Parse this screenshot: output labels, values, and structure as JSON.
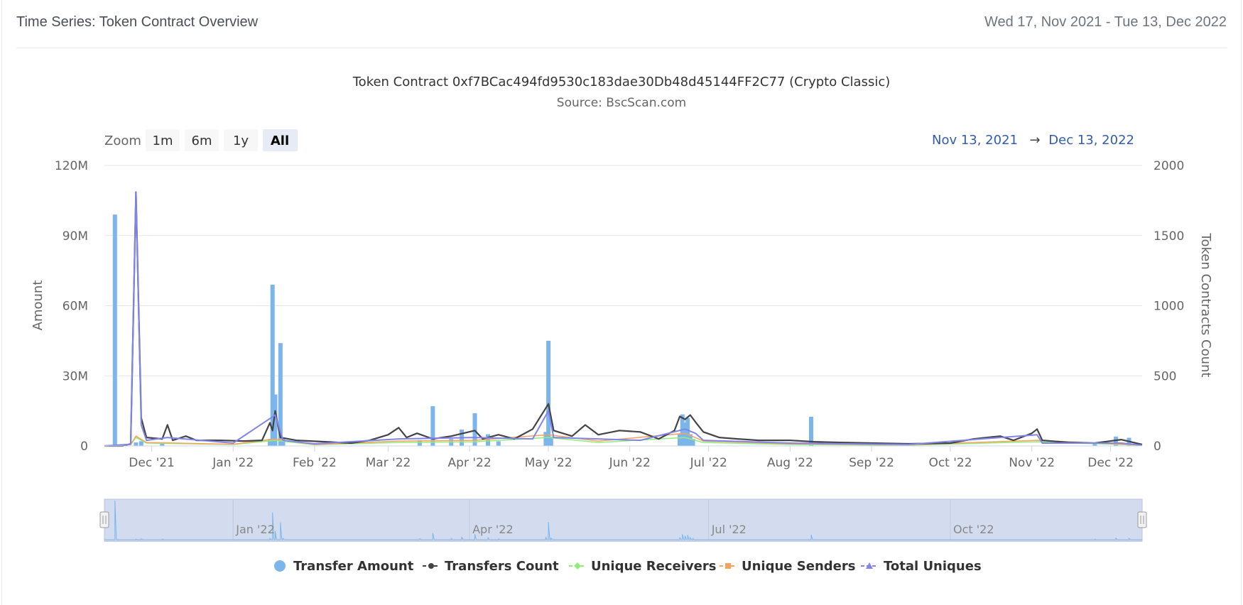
{
  "header": {
    "title": "Time Series: Token Contract Overview",
    "date_range": "Wed 17, Nov 2021 - Tue 13, Dec 2022"
  },
  "range_selector": {
    "zoom_label": "Zoom",
    "buttons": [
      "1m",
      "6m",
      "1y",
      "All"
    ],
    "selected": "All",
    "from": "Nov 13, 2021",
    "arrow": "→",
    "to": "Dec 13, 2022"
  },
  "navigator_labels": [
    "Jan '22",
    "Apr '22",
    "Jul '22",
    "Oct '22"
  ],
  "colors": {
    "transfer_amount": "#7cb5ec",
    "transfers_count": "#434348",
    "unique_receivers": "#90ed7d",
    "unique_senders": "#f7a35c",
    "total_uniques": "#8085e9",
    "navigator_fill": "#d3dcef"
  },
  "chart_data": {
    "type": "bar",
    "title": "Token Contract 0xf7BCac494fd9530c183dae30Db48d45144FF2C77 (Crypto Classic)",
    "subtitle": "Source: BscScan.com",
    "ylabel": "Amount",
    "y2label": "Token Contracts Count",
    "ylim": [
      0,
      120000000
    ],
    "y2lim": [
      0,
      2000
    ],
    "yticks": [
      "0",
      "30M",
      "60M",
      "90M",
      "120M"
    ],
    "y2ticks": [
      "0",
      "500",
      "1000",
      "1500",
      "2000"
    ],
    "xlim": [
      "2021-11-13",
      "2022-12-13"
    ],
    "xticks": [
      {
        "label": "Dec '21",
        "date": "2021-12-01"
      },
      {
        "label": "Jan '22",
        "date": "2022-01-01"
      },
      {
        "label": "Feb '22",
        "date": "2022-02-01"
      },
      {
        "label": "Mar '22",
        "date": "2022-03-01"
      },
      {
        "label": "Apr '22",
        "date": "2022-04-01"
      },
      {
        "label": "May '22",
        "date": "2022-05-01"
      },
      {
        "label": "Jun '22",
        "date": "2022-06-01"
      },
      {
        "label": "Jul '22",
        "date": "2022-07-01"
      },
      {
        "label": "Aug '22",
        "date": "2022-08-01"
      },
      {
        "label": "Sep '22",
        "date": "2022-09-01"
      },
      {
        "label": "Oct '22",
        "date": "2022-10-01"
      },
      {
        "label": "Nov '22",
        "date": "2022-11-01"
      },
      {
        "label": "Dec '22",
        "date": "2022-12-01"
      }
    ],
    "grid": true,
    "legend_position": "bottom-center",
    "series": [
      {
        "name": "Transfer Amount",
        "type": "column",
        "axis": "left",
        "points": [
          [
            "2021-11-17",
            99000000
          ],
          [
            "2021-11-25",
            1500000
          ],
          [
            "2021-11-27",
            2000000
          ],
          [
            "2021-12-05",
            1000000
          ],
          [
            "2022-01-15",
            3000000
          ],
          [
            "2022-01-16",
            69000000
          ],
          [
            "2022-01-17",
            22000000
          ],
          [
            "2022-01-19",
            44000000
          ],
          [
            "2022-01-20",
            3000000
          ],
          [
            "2022-03-13",
            2500000
          ],
          [
            "2022-03-18",
            17000000
          ],
          [
            "2022-03-25",
            3000000
          ],
          [
            "2022-03-29",
            7000000
          ],
          [
            "2022-04-03",
            14000000
          ],
          [
            "2022-04-08",
            5000000
          ],
          [
            "2022-04-12",
            2000000
          ],
          [
            "2022-04-30",
            6000000
          ],
          [
            "2022-05-01",
            45000000
          ],
          [
            "2022-05-02",
            4000000
          ],
          [
            "2022-06-20",
            5000000
          ],
          [
            "2022-06-21",
            13500000
          ],
          [
            "2022-06-22",
            10000000
          ],
          [
            "2022-06-23",
            12000000
          ],
          [
            "2022-06-24",
            5000000
          ],
          [
            "2022-06-25",
            3000000
          ],
          [
            "2022-08-09",
            12500000
          ],
          [
            "2022-11-25",
            1000000
          ],
          [
            "2022-12-03",
            4000000
          ],
          [
            "2022-12-08",
            3500000
          ]
        ]
      },
      {
        "name": "Transfers Count",
        "type": "line",
        "axis": "right",
        "points": [
          [
            "2021-11-13",
            0
          ],
          [
            "2021-11-20",
            0
          ],
          [
            "2021-11-23",
            15
          ],
          [
            "2021-11-25",
            1810
          ],
          [
            "2021-11-27",
            200
          ],
          [
            "2021-11-29",
            60
          ],
          [
            "2021-12-05",
            50
          ],
          [
            "2021-12-07",
            150
          ],
          [
            "2021-12-09",
            40
          ],
          [
            "2021-12-14",
            70
          ],
          [
            "2021-12-18",
            40
          ],
          [
            "2021-12-27",
            40
          ],
          [
            "2022-01-05",
            35
          ],
          [
            "2022-01-12",
            40
          ],
          [
            "2022-01-15",
            165
          ],
          [
            "2022-01-16",
            110
          ],
          [
            "2022-01-17",
            250
          ],
          [
            "2022-01-19",
            60
          ],
          [
            "2022-01-25",
            40
          ],
          [
            "2022-02-05",
            30
          ],
          [
            "2022-02-15",
            20
          ],
          [
            "2022-02-22",
            40
          ],
          [
            "2022-03-01",
            80
          ],
          [
            "2022-03-05",
            130
          ],
          [
            "2022-03-08",
            60
          ],
          [
            "2022-03-12",
            90
          ],
          [
            "2022-03-18",
            50
          ],
          [
            "2022-03-25",
            70
          ],
          [
            "2022-04-03",
            110
          ],
          [
            "2022-04-06",
            50
          ],
          [
            "2022-04-12",
            80
          ],
          [
            "2022-04-18",
            50
          ],
          [
            "2022-04-25",
            120
          ],
          [
            "2022-05-01",
            300
          ],
          [
            "2022-05-03",
            110
          ],
          [
            "2022-05-10",
            70
          ],
          [
            "2022-05-15",
            150
          ],
          [
            "2022-05-20",
            80
          ],
          [
            "2022-05-28",
            110
          ],
          [
            "2022-06-05",
            100
          ],
          [
            "2022-06-12",
            50
          ],
          [
            "2022-06-18",
            110
          ],
          [
            "2022-06-20",
            210
          ],
          [
            "2022-06-22",
            190
          ],
          [
            "2022-06-24",
            220
          ],
          [
            "2022-06-26",
            170
          ],
          [
            "2022-06-29",
            100
          ],
          [
            "2022-07-05",
            60
          ],
          [
            "2022-07-12",
            50
          ],
          [
            "2022-07-20",
            40
          ],
          [
            "2022-08-01",
            40
          ],
          [
            "2022-08-10",
            30
          ],
          [
            "2022-08-20",
            25
          ],
          [
            "2022-09-01",
            20
          ],
          [
            "2022-09-15",
            15
          ],
          [
            "2022-10-01",
            20
          ],
          [
            "2022-10-10",
            50
          ],
          [
            "2022-10-20",
            70
          ],
          [
            "2022-10-25",
            40
          ],
          [
            "2022-11-01",
            90
          ],
          [
            "2022-11-03",
            120
          ],
          [
            "2022-11-05",
            40
          ],
          [
            "2022-11-15",
            25
          ],
          [
            "2022-11-25",
            20
          ],
          [
            "2022-12-05",
            45
          ],
          [
            "2022-12-13",
            10
          ]
        ]
      },
      {
        "name": "Unique Receivers",
        "type": "line",
        "axis": "right",
        "points": [
          [
            "2021-11-13",
            0
          ],
          [
            "2021-11-23",
            10
          ],
          [
            "2021-11-25",
            60
          ],
          [
            "2021-11-29",
            20
          ],
          [
            "2022-01-01",
            10
          ],
          [
            "2022-01-17",
            40
          ],
          [
            "2022-02-01",
            8
          ],
          [
            "2022-03-05",
            25
          ],
          [
            "2022-04-03",
            30
          ],
          [
            "2022-05-01",
            60
          ],
          [
            "2022-05-20",
            25
          ],
          [
            "2022-06-22",
            60
          ],
          [
            "2022-06-29",
            25
          ],
          [
            "2022-08-01",
            10
          ],
          [
            "2022-09-15",
            5
          ],
          [
            "2022-11-03",
            30
          ],
          [
            "2022-12-13",
            5
          ]
        ]
      },
      {
        "name": "Unique Senders",
        "type": "line",
        "axis": "right",
        "points": [
          [
            "2021-11-13",
            0
          ],
          [
            "2021-11-23",
            10
          ],
          [
            "2021-11-25",
            70
          ],
          [
            "2021-11-29",
            25
          ],
          [
            "2022-01-01",
            12
          ],
          [
            "2022-01-17",
            50
          ],
          [
            "2022-02-01",
            10
          ],
          [
            "2022-03-05",
            35
          ],
          [
            "2022-04-03",
            40
          ],
          [
            "2022-05-01",
            80
          ],
          [
            "2022-05-20",
            35
          ],
          [
            "2022-06-22",
            90
          ],
          [
            "2022-06-29",
            35
          ],
          [
            "2022-08-01",
            15
          ],
          [
            "2022-09-15",
            8
          ],
          [
            "2022-11-03",
            40
          ],
          [
            "2022-12-13",
            5
          ]
        ]
      },
      {
        "name": "Total Uniques",
        "type": "line",
        "axis": "right",
        "points": [
          [
            "2021-11-13",
            0
          ],
          [
            "2021-11-23",
            12
          ],
          [
            "2021-11-25",
            1810
          ],
          [
            "2021-11-27",
            150
          ],
          [
            "2021-11-29",
            40
          ],
          [
            "2021-12-07",
            60
          ],
          [
            "2022-01-01",
            20
          ],
          [
            "2022-01-17",
            220
          ],
          [
            "2022-01-20",
            40
          ],
          [
            "2022-02-01",
            15
          ],
          [
            "2022-03-05",
            50
          ],
          [
            "2022-04-03",
            60
          ],
          [
            "2022-04-25",
            50
          ],
          [
            "2022-05-01",
            250
          ],
          [
            "2022-05-03",
            60
          ],
          [
            "2022-05-20",
            50
          ],
          [
            "2022-06-05",
            40
          ],
          [
            "2022-06-22",
            120
          ],
          [
            "2022-06-26",
            90
          ],
          [
            "2022-06-29",
            40
          ],
          [
            "2022-08-01",
            20
          ],
          [
            "2022-09-15",
            10
          ],
          [
            "2022-11-03",
            80
          ],
          [
            "2022-11-05",
            20
          ],
          [
            "2022-12-05",
            20
          ],
          [
            "2022-12-13",
            5
          ]
        ]
      }
    ]
  }
}
